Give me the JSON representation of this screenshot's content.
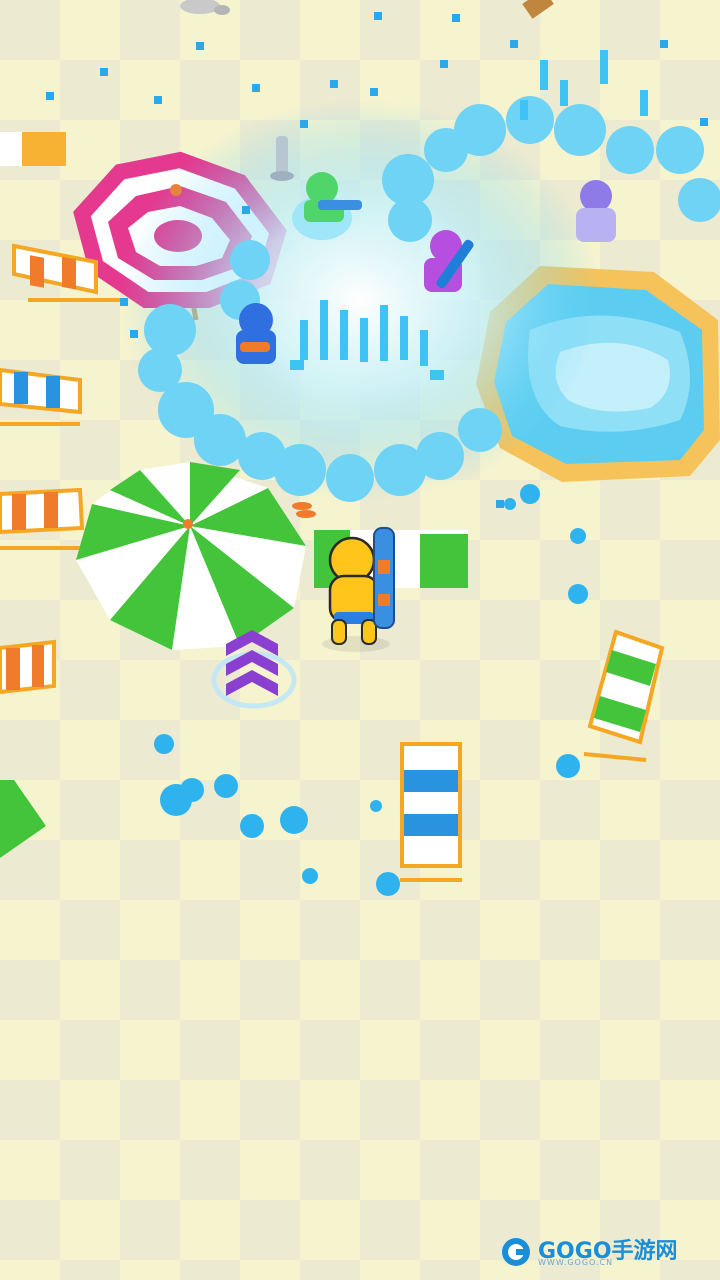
{
  "watermark": {
    "brand_text": "GOGO手游网",
    "url_text": "WWW.GOGO.CN"
  },
  "colors": {
    "floor_light": "#f6f3cf",
    "floor_dark": "#ebe8b8",
    "water_blue": "#3ec3f4",
    "splash_light": "#b4ecfb",
    "player_yellow": "#ffc51a",
    "umbrella_pink": "#e4398e",
    "umbrella_green": "#43c43a",
    "pool_rim": "#f6c35a",
    "pool_water": "#5ccdf0",
    "arrow_purple": "#8b3fd1",
    "chair_orange": "#f07b2b",
    "chair_blue": "#2a93e0"
  },
  "icons": {
    "player": "yellow-character-with-water-gun",
    "enemies": [
      "green-enemy",
      "purple-enemy",
      "blue-enemy",
      "lavender-enemy"
    ],
    "direction_arrow": "purple-chevron-stack-icon",
    "logo": "gogo-logo-icon"
  }
}
